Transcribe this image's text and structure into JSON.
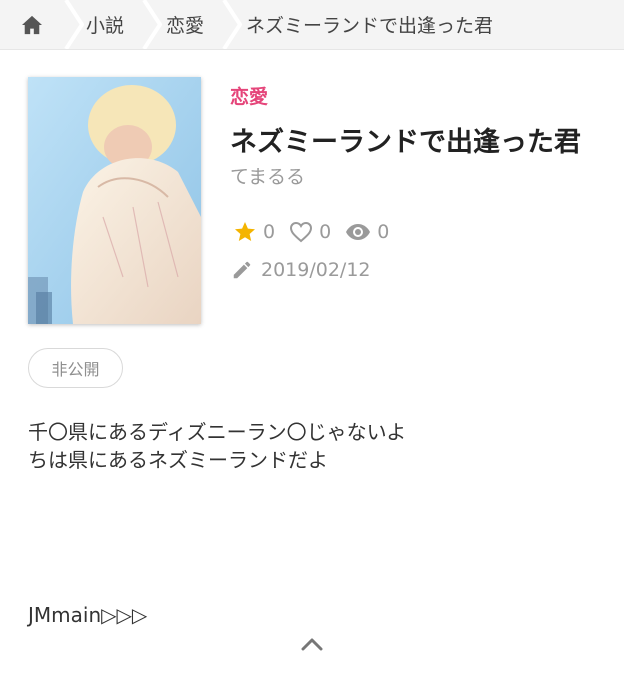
{
  "breadcrumb": {
    "home_icon": "home-icon",
    "items": [
      "小説",
      "恋愛",
      "ネズミーランドで出逢った君"
    ]
  },
  "work": {
    "genre": "恋愛",
    "title": "ネズミーランドで出逢った君",
    "author": "てまるる",
    "stars": "0",
    "likes": "0",
    "views": "0",
    "date": "2019/02/12",
    "visibility": "非公開",
    "description": [
      "千〇県にあるディズニーラン〇じゃないよ",
      "ちは県にあるネズミーランドだよ"
    ],
    "tag_line": "JMmain▷▷▷"
  },
  "colors": {
    "accent": "#e5457a",
    "star": "#f4b400",
    "muted": "#9a9a9a"
  }
}
